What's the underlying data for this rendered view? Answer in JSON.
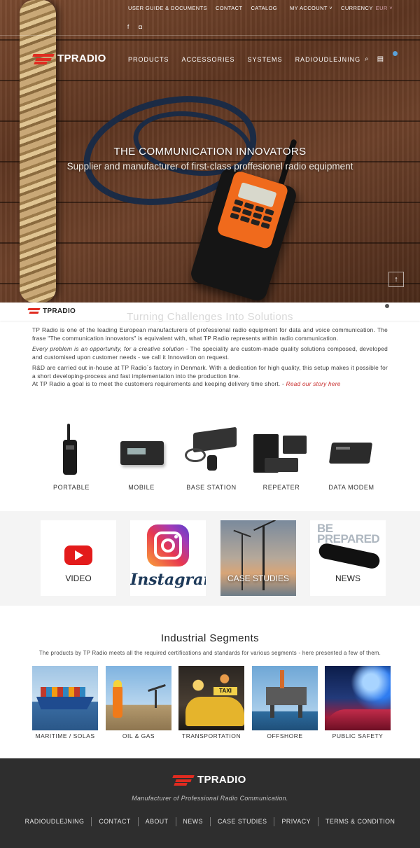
{
  "topbar": {
    "links": [
      "USER GUIDE & DOCUMENTS",
      "CONTACT",
      "CATALOG",
      "MY ACCOUNT ˅",
      "CURRENCY"
    ],
    "currency_value": "EUR ˅",
    "socials": [
      "f",
      "◘"
    ]
  },
  "brand": {
    "name": "TPRADIO",
    "name_tp": "TP",
    "name_radio": "RADIO"
  },
  "nav": {
    "items": [
      "PRODUCTS",
      "ACCESSORIES",
      "SYSTEMS",
      "RADIOUDLEJNING"
    ],
    "icons": [
      "search-icon",
      "cart-icon"
    ]
  },
  "hero": {
    "title": "THE COMMUNICATION INNOVATORS",
    "subtitle": "Supplier and manufacturer of first-class proffesionel radio equipment",
    "scroll_glyph": "↑"
  },
  "intro": {
    "heading": "Turning Challenges Into Solutions",
    "p1": "TP Radio is one of the leading European manufacturers of professional radio equipment for data and voice communication. The frase \"The communication innovators\" is equivalent with, what TP Radio represents within radio communication.",
    "p2_em": "Every problem is an opportunity, for a creative solution",
    "p2_rest": " - The speciality are custom-made quality solutions composed, developed and customised upon customer needs - we call it Innovation on request.",
    "p3": "R&D are carried out in-house at TP Radio´s factory in Denmark. With a dedication for high quality, this setup makes it possible for a short developing-process and fast implementation into the production line.",
    "p4": "At TP Radio a goal is to meet the customers requirements and keeping delivery time short. - ",
    "p4_link": "Read our story here"
  },
  "products": [
    "PORTABLE",
    "MOBILE",
    "BASE STATION",
    "REPEATER",
    "DATA MODEM"
  ],
  "tiles": {
    "video": "VIDEO",
    "instagram": "Instagram",
    "case_studies": "CASE STUDIES",
    "news": "NEWS",
    "news_art_1": "BE",
    "news_art_2": "PREPARED"
  },
  "segments": {
    "title": "Industrial Segments",
    "subtitle": "The products by TP Radio meets all the required certifications and standards for various segments - here presented a few of them.",
    "items": [
      "MARITIME / SOLAS",
      "OIL & GAS",
      "TRANSPORTATION",
      "OFFSHORE",
      "PUBLIC SAFETY"
    ],
    "taxi_sign": "TAXI"
  },
  "footer": {
    "tagline": "Manufacturer of Professional Radio Communication.",
    "links": [
      "RADIOUDLEJNING",
      "CONTACT",
      "ABOUT",
      "NEWS",
      "CASE STUDIES",
      "PRIVACY",
      "TERMS & CONDITION"
    ]
  },
  "colors": {
    "brand_red": "#e02b20",
    "footer_bg": "#2e2e2e",
    "link_red": "#c72a2a"
  }
}
